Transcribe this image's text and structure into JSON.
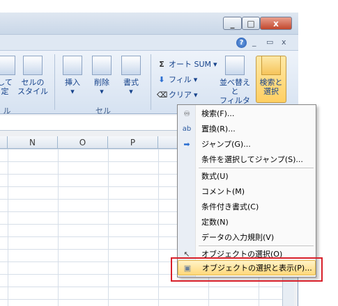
{
  "window": {
    "min_label": "_",
    "max_label": "□",
    "close_label": "x"
  },
  "ribbon_top": {
    "help_label": "?",
    "mdi_controls": [
      "_",
      "▭",
      "x"
    ]
  },
  "styles_group": {
    "button1_label_line1": "して",
    "button1_label_line2": "定",
    "button2_label_line1": "セルの",
    "button2_label_line2": "スタイル",
    "group_label": "ル"
  },
  "cells_group": {
    "insert_label": "挿入",
    "delete_label": "削除",
    "format_label": "書式",
    "group_label": "セル"
  },
  "editing_group": {
    "autosum_label": "オート SUM",
    "fill_label": "フィル",
    "clear_label": "クリア",
    "sort_label_line1": "並べ替えと",
    "sort_label_line2": "フィルタ",
    "find_label_line1": "検索と",
    "find_label_line2": "選択"
  },
  "sheet": {
    "columns": [
      "N",
      "O",
      "P"
    ]
  },
  "menu": {
    "items": [
      {
        "label": "検索(F)...",
        "icon": "binoculars-icon",
        "glyph": "👓"
      },
      {
        "label": "置換(R)...",
        "icon": "replace-icon",
        "glyph": "ab"
      },
      {
        "label": "ジャンプ(G)...",
        "icon": "arrow-right-icon",
        "glyph": "➡"
      },
      {
        "label": "条件を選択してジャンプ(S)...",
        "icon": "",
        "glyph": ""
      },
      {
        "label": "数式(U)",
        "icon": "",
        "glyph": ""
      },
      {
        "label": "コメント(M)",
        "icon": "",
        "glyph": ""
      },
      {
        "label": "条件付き書式(C)",
        "icon": "",
        "glyph": ""
      },
      {
        "label": "定数(N)",
        "icon": "",
        "glyph": ""
      },
      {
        "label": "データの入力規則(V)",
        "icon": "",
        "glyph": ""
      },
      {
        "label": "オブジェクトの選択(O)",
        "icon": "pointer-icon",
        "glyph": "↖"
      },
      {
        "label": "オブジェクトの選択と表示(P)...",
        "icon": "selection-pane-icon",
        "glyph": "▣"
      }
    ]
  },
  "colors": {
    "highlight_box": "#d8202a",
    "hover": "#ffd87a",
    "ribbon_text": "#15428b"
  }
}
